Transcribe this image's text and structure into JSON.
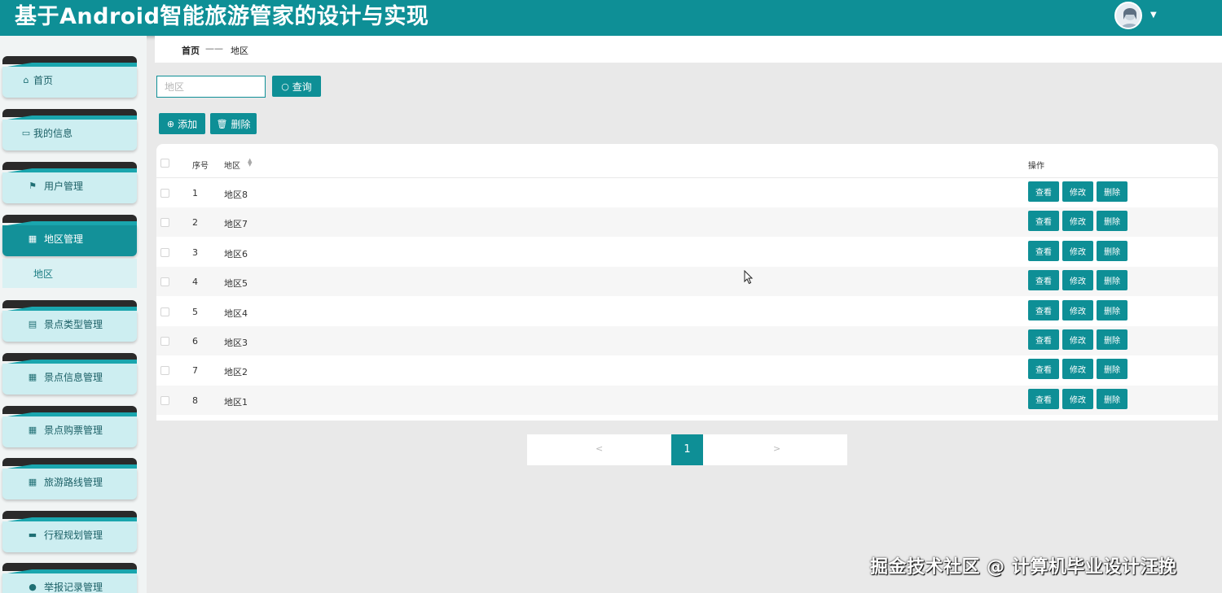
{
  "app": {
    "title": "基于Android智能旅游管家的设计与实现",
    "avatar_icon": "user-avatar",
    "dropdown_icon": "caret-down-icon"
  },
  "sidebar": {
    "items": [
      {
        "label": "首页",
        "icon": "home-icon",
        "glyph": "⌂",
        "active": false
      },
      {
        "label": "我的信息",
        "icon": "id-card-icon",
        "glyph": "▭",
        "active": false
      },
      {
        "label": "用户管理",
        "icon": "flag-icon",
        "glyph": "⚑",
        "active": false
      },
      {
        "label": "地区管理",
        "icon": "grid-icon",
        "glyph": "▦",
        "active": true
      },
      {
        "label": "景点类型管理",
        "icon": "clipboard-icon",
        "glyph": "▤",
        "active": false
      },
      {
        "label": "景点信息管理",
        "icon": "grid-icon",
        "glyph": "▦",
        "active": false
      },
      {
        "label": "景点购票管理",
        "icon": "grid-icon",
        "glyph": "▦",
        "active": false
      },
      {
        "label": "旅游路线管理",
        "icon": "grid-icon",
        "glyph": "▦",
        "active": false
      },
      {
        "label": "行程规划管理",
        "icon": "briefcase-icon",
        "glyph": "▬",
        "active": false
      },
      {
        "label": "举报记录管理",
        "icon": "user-icon",
        "glyph": "●",
        "active": false
      }
    ],
    "submenu": {
      "label": "地区"
    }
  },
  "breadcrumb": {
    "home": "首页",
    "separator": "——",
    "current": "地区"
  },
  "search": {
    "placeholder": "地区",
    "value": "",
    "button_label": "查询",
    "button_icon": "search-icon"
  },
  "toolbar": {
    "add_label": "添加",
    "add_icon": "plus-circle-icon",
    "delete_label": "删除",
    "delete_icon": "trash-icon"
  },
  "table": {
    "columns": {
      "index": "序号",
      "region": "地区",
      "actions": "操作"
    },
    "rows": [
      {
        "index": "1",
        "region": "地区8"
      },
      {
        "index": "2",
        "region": "地区7"
      },
      {
        "index": "3",
        "region": "地区6"
      },
      {
        "index": "4",
        "region": "地区5"
      },
      {
        "index": "5",
        "region": "地区4"
      },
      {
        "index": "6",
        "region": "地区3"
      },
      {
        "index": "7",
        "region": "地区2"
      },
      {
        "index": "8",
        "region": "地区1"
      }
    ],
    "row_actions": {
      "view": "查看",
      "edit": "修改",
      "delete": "删除"
    }
  },
  "pagination": {
    "prev": "<",
    "current": "1",
    "next": ">"
  },
  "watermark": "掘金技术社区 @ 计算机毕业设计汪挽",
  "colors": {
    "primary": "#0e8f96",
    "menu_bg": "#cdeef1",
    "menu_tab": "#2a2a2a"
  }
}
